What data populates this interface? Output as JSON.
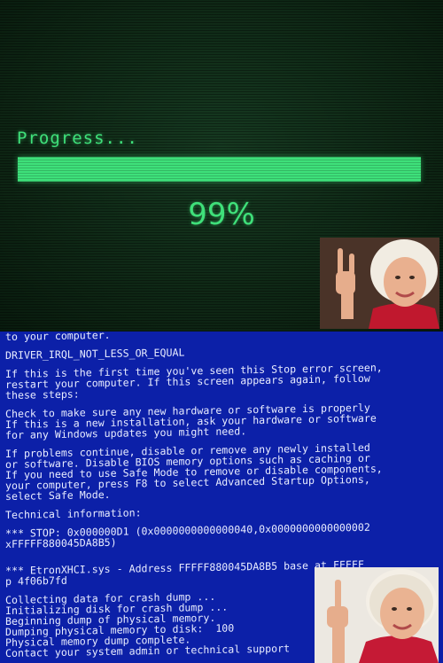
{
  "progress_screen": {
    "label": "Progress...",
    "percent_text": "99%",
    "progress_value": 0.99,
    "accent_color": "#3fe07a"
  },
  "bsod": {
    "background_color": "#0c20a8",
    "lines": [
      "to your computer.",
      "",
      "DRIVER_IRQL_NOT_LESS_OR_EQUAL",
      "",
      "If this is the first time you've seen this Stop error screen,",
      "restart your computer. If this screen appears again, follow",
      "these steps:",
      "",
      "Check to make sure any new hardware or software is properly",
      "If this is a new installation, ask your hardware or software",
      "for any Windows updates you might need.",
      "",
      "If problems continue, disable or remove any newly installed",
      "or software. Disable BIOS memory options such as caching or",
      "If you need to use Safe Mode to remove or disable components,",
      "your computer, press F8 to select Advanced Startup Options,",
      "select Safe Mode.",
      "",
      "Technical information:",
      "",
      "*** STOP: 0x000000D1 (0x0000000000000040,0x0000000000000002",
      "xFFFFF880045DA8B5)",
      "",
      "",
      "*** EtronXHCI.sys - Address FFFFF880045DA8B5 base at FFFFF",
      "p 4f06b7fd",
      "",
      "Collecting data for crash dump ...",
      "Initializing disk for crash dump ...",
      "Beginning dump of physical memory.",
      "Dumping physical memory to disk:  100",
      "Physical memory dump complete.",
      "Contact your system admin or technical support"
    ]
  },
  "icons": {
    "photo_top": "woman-rock-hand-photo",
    "photo_bottom": "woman-middle-finger-photo"
  }
}
